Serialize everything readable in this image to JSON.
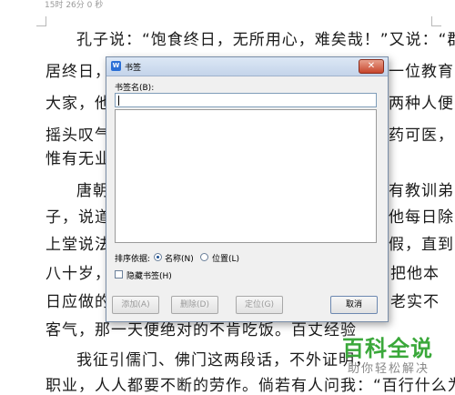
{
  "document": {
    "ruler_text": "15时 26分 0 秒",
    "lines": [
      "孔子说：“饱食终日，无所用心，难矣哉！”又说：“群",
      "居终日，",
      "一位教育",
      "大家，他",
      "两种人便",
      "摇头叹气",
      "药可医，",
      "惟有无业",
      "唐朝",
      "有教训弟",
      "子，说道",
      "他每日除",
      "上堂说法",
      "假，直到",
      "八十岁，",
      "把他本",
      "日应做的",
      "老实不",
      "客气，那一天便绝对的不肯吃饭。百丈经验",
      "我征引儒门、佛门这两段话，不外证明，",
      "职业，人人都要不断的劳作。倘若有人问我：“百行什么为"
    ]
  },
  "dialog": {
    "title": "书签",
    "app_icon_letter": "W",
    "close_symbol": "✕",
    "name_label": "书签名(B):",
    "name_value": "",
    "sort_label": "排序依据:",
    "sort_options": [
      {
        "label": "名称(N)",
        "selected": true
      },
      {
        "label": "位置(L)",
        "selected": false
      }
    ],
    "hidden_bookmarks_label": "隐藏书签(H)",
    "hidden_bookmarks_checked": false,
    "buttons": {
      "add": "添加(A)",
      "delete": "删除(D)",
      "goto": "定位(G)",
      "cancel": "取消"
    }
  },
  "watermark": {
    "title": "百科全说",
    "subtitle": "助你轻松解决"
  }
}
